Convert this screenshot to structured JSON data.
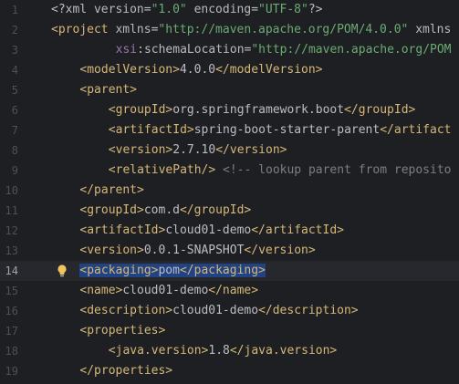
{
  "lines": [
    {
      "n": "1",
      "indent": 0,
      "tokens": [
        {
          "t": "pi",
          "v": "<?xml "
        },
        {
          "t": "attr",
          "v": "version"
        },
        {
          "t": "pi",
          "v": "="
        },
        {
          "t": "str",
          "v": "\"1.0\""
        },
        {
          "t": "pi",
          "v": " "
        },
        {
          "t": "attr",
          "v": "encoding"
        },
        {
          "t": "pi",
          "v": "="
        },
        {
          "t": "str",
          "v": "\"UTF-8\""
        },
        {
          "t": "pi",
          "v": "?>"
        }
      ]
    },
    {
      "n": "2",
      "indent": 0,
      "tokens": [
        {
          "t": "br",
          "v": "<project "
        },
        {
          "t": "attr",
          "v": "xmlns"
        },
        {
          "t": "txt",
          "v": "="
        },
        {
          "t": "str",
          "v": "\"http://maven.apache.org/POM/4.0.0\""
        },
        {
          "t": "txt",
          "v": " "
        },
        {
          "t": "attr",
          "v": "xmlns"
        }
      ]
    },
    {
      "n": "3",
      "indent": 9,
      "tokens": [
        {
          "t": "ns",
          "v": "xsi"
        },
        {
          "t": "attr",
          "v": ":schemaLocation"
        },
        {
          "t": "txt",
          "v": "="
        },
        {
          "t": "str",
          "v": "\"http://maven.apache.org/POM"
        }
      ]
    },
    {
      "n": "4",
      "indent": 4,
      "tokens": [
        {
          "t": "tag",
          "v": "<modelVersion>"
        },
        {
          "t": "txt",
          "v": "4.0.0"
        },
        {
          "t": "tag",
          "v": "</modelVersion>"
        }
      ]
    },
    {
      "n": "5",
      "indent": 4,
      "tokens": [
        {
          "t": "tag",
          "v": "<parent>"
        }
      ]
    },
    {
      "n": "6",
      "indent": 8,
      "tokens": [
        {
          "t": "tag",
          "v": "<groupId>"
        },
        {
          "t": "txt",
          "v": "org.springframework.boot"
        },
        {
          "t": "tag",
          "v": "</groupId>"
        }
      ]
    },
    {
      "n": "7",
      "indent": 8,
      "tokens": [
        {
          "t": "tag",
          "v": "<artifactId>"
        },
        {
          "t": "txt",
          "v": "spring-boot-starter-parent"
        },
        {
          "t": "tag",
          "v": "</artifact"
        }
      ]
    },
    {
      "n": "8",
      "indent": 8,
      "tokens": [
        {
          "t": "tag",
          "v": "<version>"
        },
        {
          "t": "txt",
          "v": "2.7.10"
        },
        {
          "t": "tag",
          "v": "</version>"
        }
      ]
    },
    {
      "n": "9",
      "indent": 8,
      "tokens": [
        {
          "t": "tag",
          "v": "<relativePath/>"
        },
        {
          "t": "txt",
          "v": " "
        },
        {
          "t": "cmt",
          "v": "<!-- lookup parent from reposito"
        }
      ]
    },
    {
      "n": "10",
      "indent": 4,
      "tokens": [
        {
          "t": "tag",
          "v": "</parent>"
        }
      ]
    },
    {
      "n": "11",
      "indent": 4,
      "tokens": [
        {
          "t": "tag",
          "v": "<groupId>"
        },
        {
          "t": "txt",
          "v": "com.d"
        },
        {
          "t": "tag",
          "v": "</groupId>"
        }
      ]
    },
    {
      "n": "12",
      "indent": 4,
      "tokens": [
        {
          "t": "tag",
          "v": "<artifactId>"
        },
        {
          "t": "txt",
          "v": "cloud01-demo"
        },
        {
          "t": "tag",
          "v": "</artifactId>"
        }
      ]
    },
    {
      "n": "13",
      "indent": 4,
      "tokens": [
        {
          "t": "tag",
          "v": "<version>"
        },
        {
          "t": "txt",
          "v": "0.0.1-SNAPSHOT"
        },
        {
          "t": "tag",
          "v": "</version>"
        }
      ]
    },
    {
      "n": "14",
      "indent": 4,
      "current": true,
      "selected": true,
      "bulb": true,
      "tokens": [
        {
          "t": "tag",
          "v": "<packaging>"
        },
        {
          "t": "txt",
          "v": "pom"
        },
        {
          "t": "tag",
          "v": "</packaging>"
        }
      ]
    },
    {
      "n": "15",
      "indent": 4,
      "tokens": [
        {
          "t": "tag",
          "v": "<name>"
        },
        {
          "t": "txt",
          "v": "cloud01-demo"
        },
        {
          "t": "tag",
          "v": "</name>"
        }
      ]
    },
    {
      "n": "16",
      "indent": 4,
      "tokens": [
        {
          "t": "tag",
          "v": "<description>"
        },
        {
          "t": "txt",
          "v": "cloud01-demo"
        },
        {
          "t": "tag",
          "v": "</description>"
        }
      ]
    },
    {
      "n": "17",
      "indent": 4,
      "tokens": [
        {
          "t": "tag",
          "v": "<properties>"
        }
      ]
    },
    {
      "n": "18",
      "indent": 8,
      "tokens": [
        {
          "t": "tag",
          "v": "<java.version>"
        },
        {
          "t": "txt",
          "v": "1.8"
        },
        {
          "t": "tag",
          "v": "</java.version>"
        }
      ]
    },
    {
      "n": "19",
      "indent": 4,
      "tokens": [
        {
          "t": "tag",
          "v": "</properties>"
        }
      ]
    }
  ],
  "icons": {
    "intention_bulb": "lightbulb-icon"
  },
  "colors": {
    "background": "#1e1f22",
    "selection": "#214283",
    "tag": "#d5b778",
    "string": "#6aab73",
    "comment": "#7a7e85",
    "text": "#bcbec4"
  }
}
